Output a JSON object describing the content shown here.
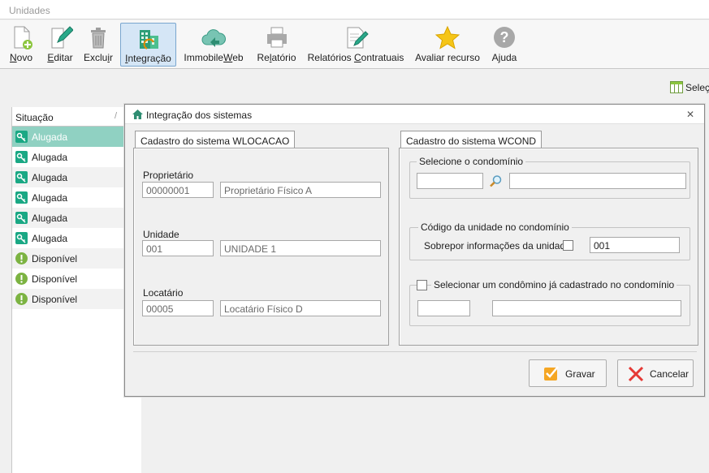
{
  "window": {
    "title": "Unidades"
  },
  "toolbar": {
    "items": [
      {
        "label": "Novo",
        "key": "N",
        "rest": "ovo",
        "icon": "new-document-icon"
      },
      {
        "label": "Editar",
        "key": "E",
        "rest": "ditar",
        "icon": "edit-pencil-icon"
      },
      {
        "label": "Excluir",
        "pre": "Exclu",
        "key": "i",
        "rest": "r",
        "icon": "trash-icon"
      },
      {
        "label": "Integração",
        "key": "I",
        "rest": "ntegração",
        "icon": "buildings-icon"
      },
      {
        "label": "ImmobileWeb",
        "pre": "Immobile",
        "key": "W",
        "rest": "eb",
        "icon": "cloud-upload-icon"
      },
      {
        "label": "Relatório",
        "pre": "Re",
        "key": "l",
        "rest": "atório",
        "icon": "printer-icon"
      },
      {
        "label": "Relatórios Contratuais",
        "pre": "Relatórios ",
        "key": "C",
        "rest": "ontratuais",
        "icon": "document-sign-icon"
      },
      {
        "label": "Avaliar recurso",
        "icon": "star-icon"
      },
      {
        "label": "Ajuda",
        "pre": "A",
        "key": "j",
        "rest": "uda",
        "icon": "help-icon"
      }
    ],
    "right_label": "Seleç"
  },
  "grid": {
    "header": "Situação",
    "rows": [
      {
        "status": "Alugada",
        "icon": "key-icon",
        "selected": true
      },
      {
        "status": "Alugada",
        "icon": "key-icon"
      },
      {
        "status": "Alugada",
        "icon": "key-icon"
      },
      {
        "status": "Alugada",
        "icon": "key-icon"
      },
      {
        "status": "Alugada",
        "icon": "key-icon"
      },
      {
        "status": "Alugada",
        "icon": "key-icon"
      },
      {
        "status": "Disponível",
        "icon": "alert-icon"
      },
      {
        "status": "Disponível",
        "icon": "alert-icon"
      },
      {
        "status": "Disponível",
        "icon": "alert-icon"
      }
    ],
    "colors": {
      "selected": "#90d1c2",
      "key": "#1aa884",
      "alert": "#7cb342"
    }
  },
  "dialog": {
    "title": "Integração dos sistemas",
    "left_tab": {
      "label": "Cadastro do sistema WLOCACAO",
      "owner_label": "Proprietário",
      "owner_code": "00000001",
      "owner_name": "Proprietário Físico A",
      "unit_label": "Unidade",
      "unit_code": "001",
      "unit_name": "UNIDADE 1",
      "tenant_label": "Locatário",
      "tenant_code": "00005",
      "tenant_name": "Locatário Físico D"
    },
    "right_tab": {
      "label": "Cadastro do sistema WCOND",
      "condo_group": "Selecione o condomínio",
      "condo_code": "",
      "condo_name": "",
      "unit_group": "Código da unidade no condomínio",
      "override_label": "Sobrepor informações da unidade",
      "override_checked": false,
      "unit_code": "001",
      "existing_group": "Selecionar um condômino já cadastrado no condomínio",
      "existing_checked": false,
      "existing_code": "",
      "existing_name": ""
    },
    "save_label": "Gravar",
    "cancel_label": "Cancelar"
  }
}
